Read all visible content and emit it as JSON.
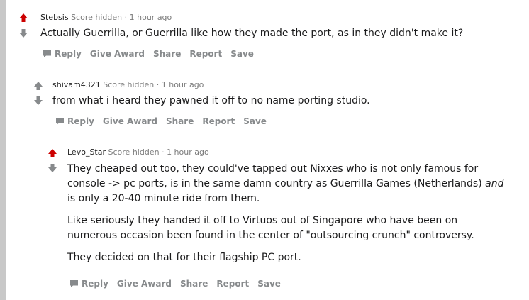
{
  "comments": [
    {
      "author": "Stebsis",
      "score": "Score hidden",
      "time": "1 hour ago",
      "paragraphs": [
        "Actually Guerrilla, or Guerrilla like how they made the port, as in they didn't make it?"
      ],
      "upvote_color": "#cc0000"
    },
    {
      "author": "shivam4321",
      "score": "Score hidden",
      "time": "1 hour ago",
      "paragraphs": [
        "from what i heard they pawned it off to no name porting studio."
      ],
      "upvote_color": "#878a8c"
    },
    {
      "author": "Levo_Star",
      "score": "Score hidden",
      "time": "1 hour ago",
      "paragraph1_before": "They cheaped out too, they could've tapped out Nixxes who is not only famous for console -> pc ports, is in the same damn country as Guerrilla Games (Netherlands) ",
      "paragraph1_em": "and",
      "paragraph1_after": " is only a 20-40 minute ride from them.",
      "paragraph2": "Like seriously they handed it off to Virtuos out of Singapore who have been on numerous occasion been found in the center of \"outsourcing crunch\" controversy.",
      "paragraph3": "They decided on that for their flagship PC port.",
      "upvote_color": "#cc0000"
    }
  ],
  "actions": {
    "reply": "Reply",
    "give_award": "Give Award",
    "share": "Share",
    "report": "Report",
    "save": "Save"
  },
  "separator": "·",
  "icons": {
    "upvote": "upvote-arrow-icon",
    "downvote": "downvote-arrow-icon",
    "reply": "comment-bubble-icon"
  }
}
